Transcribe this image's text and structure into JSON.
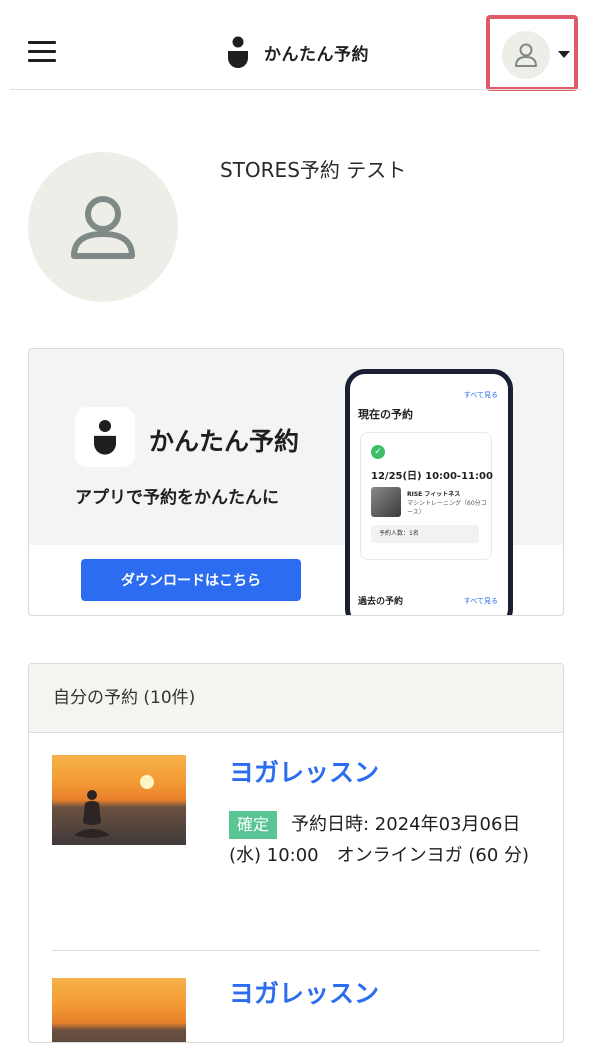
{
  "header": {
    "app_name": "かんたん予約",
    "menu_icon": "hamburger-icon",
    "user_icon": "user-icon",
    "caret_icon": "caret-down-icon",
    "highlight_color": "#e05a6a"
  },
  "profile": {
    "name": "STORES予約 テスト",
    "avatar_icon": "user-icon"
  },
  "banner": {
    "app_title": "かんたん予約",
    "subtitle": "アプリで予約をかんたんに",
    "button_label": "ダウンロードはこちら",
    "button_color": "#2b6cf0",
    "phone": {
      "see_all": "すべて見る",
      "current_heading": "現在の予約",
      "date": "12/25(日) 10:00-11:00",
      "shop": "RISE フィットネス",
      "course": "マシントレーニング（60分コース）",
      "count": "予約人数：1名",
      "past_heading": "過去の予約",
      "see_all_past": "すべて見る"
    }
  },
  "reservations": {
    "heading": "自分の予約 (10件)",
    "items": [
      {
        "title": "ヨガレッスン",
        "status": "確定",
        "details": "予約日時: 2024年03月06日 (水) 10:00　オンラインヨガ (60 分)"
      },
      {
        "title": "ヨガレッスン"
      }
    ],
    "status_color": "#5ac594",
    "title_color": "#2b6cf0"
  }
}
